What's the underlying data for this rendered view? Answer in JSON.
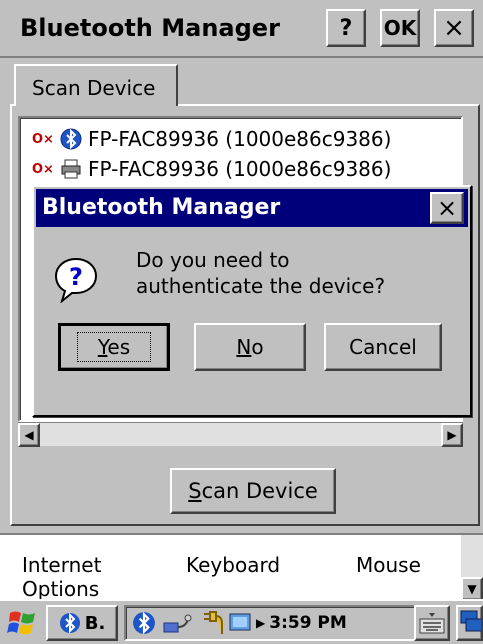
{
  "app": {
    "title": "Bluetooth Manager",
    "help_label": "?",
    "ok_label": "OK",
    "close_label": "×"
  },
  "tabs": [
    {
      "label": "Scan Device"
    }
  ],
  "device_list": {
    "items": [
      {
        "label": "FP-FAC89936 (1000e86c9386)",
        "icon": "bluetooth-globe-icon"
      },
      {
        "label": "FP-FAC89936 (1000e86c9386)",
        "icon": "printer-icon"
      }
    ]
  },
  "scan_button": {
    "prefix": "",
    "underlined": "S",
    "rest": "can Device"
  },
  "dialog": {
    "title": "Bluetooth Manager",
    "close_label": "×",
    "message_line1": "Do you need to",
    "message_line2": "authenticate the device?",
    "yes": {
      "underlined": "Y",
      "rest": "es"
    },
    "no": {
      "underlined": "N",
      "rest": "o"
    },
    "cancel": "Cancel"
  },
  "control_panel": {
    "items": [
      {
        "label": "Internet Options"
      },
      {
        "label": "Keyboard"
      },
      {
        "label": "Mouse"
      }
    ]
  },
  "taskbar": {
    "task_label": "B.",
    "clock": "3:59 PM"
  },
  "colors": {
    "titlebar_active": "#00007b",
    "face": "#c0c0c0"
  }
}
